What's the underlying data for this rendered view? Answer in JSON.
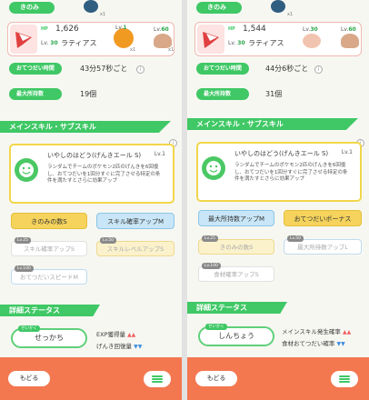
{
  "colors": {
    "green": "#3fc865",
    "orange": "#f37850",
    "yellow": "#f5d35c",
    "blue": "#c8e6f7",
    "card_pink": "#fde3e1"
  },
  "left": {
    "top_label": "きのみ",
    "fruit_count": "x1",
    "pokemon": {
      "hp_label": "HP",
      "hp_value": "1,626",
      "level_prefix": "Lv.",
      "level": "30",
      "name": "ラティアス"
    },
    "ingredients": [
      {
        "level_prefix": "Lv.",
        "level": "1",
        "count": "x1",
        "icon": "pumpkin-icon"
      },
      {
        "level_prefix": "Lv.",
        "level": "60",
        "count": "x1",
        "icon": "mushroom-icon"
      }
    ],
    "help_interval": {
      "label": "おてつだい時間",
      "value": "43分57秒ごと"
    },
    "max_inventory": {
      "label": "最大所持数",
      "value": "19個"
    },
    "section_skill": "メインスキル・サブスキル",
    "main_skill": {
      "name": "いやしのはどう(げんきエール S)",
      "level": "Lv.1",
      "description": "ランダムでチームのポケモン2匹のげんきを6回復し、おてつだいを1回分すぐに完了させる特定の条件を満たすとさらに効果アップ"
    },
    "skill_buttons": [
      {
        "label": "きのみの数S"
      },
      {
        "label": "スキル確率アップM"
      }
    ],
    "sub_skills": [
      {
        "tag": "Lv.25",
        "label": "スキル確率アップS"
      },
      {
        "tag": "Lv.50",
        "label": "スキルレベルアップS"
      },
      {
        "tag": "Lv.100",
        "label": "おてつだいスピードM"
      }
    ],
    "section_detail": "詳細ステータス",
    "nature": {
      "tag": "せいかく",
      "value": "せっかち"
    },
    "effects": [
      {
        "label": "EXP獲得量",
        "arrow": "▲▲"
      },
      {
        "label": "げんき回復量",
        "arrow": "▼▼"
      }
    ],
    "back_label": "もどる"
  },
  "right": {
    "top_label": "きのみ",
    "fruit_count": "x1",
    "pokemon": {
      "hp_label": "HP",
      "hp_value": "1,544",
      "level_prefix": "Lv.",
      "level": "30",
      "name": "ラティアス"
    },
    "ingredients": [
      {
        "level_prefix": "Lv.",
        "level": "30",
        "icon": "egg-icon"
      },
      {
        "level_prefix": "Lv.",
        "level": "60",
        "icon": "mushroom-icon"
      }
    ],
    "help_interval": {
      "label": "おてつだい時間",
      "value": "44分6秒ごと"
    },
    "max_inventory": {
      "label": "最大所持数",
      "value": "31個"
    },
    "section_skill": "メインスキル・サブスキル",
    "main_skill": {
      "name": "いやしのはどう(げんきエール S)",
      "level": "Lv.1",
      "description": "ランダムでチームのポケモン2匹のげんきを6回復し、おてつだいを1回分すぐに完了させる特定の条件を満たすとさらに効果アップ"
    },
    "skill_buttons": [
      {
        "label": "最大所持数アップM"
      },
      {
        "label": "おてつだいボーナス"
      }
    ],
    "sub_skills": [
      {
        "tag": "Lv.25",
        "label": "きのみの数S"
      },
      {
        "tag": "Lv.50",
        "label": "最大所持数アップL"
      },
      {
        "tag": "Lv.100",
        "label": "食材確率アップS"
      }
    ],
    "section_detail": "詳細ステータス",
    "nature": {
      "tag": "せいかく",
      "value": "しんちょう"
    },
    "effects": [
      {
        "label": "メインスキル発生確率",
        "arrow": "▲▲"
      },
      {
        "label": "食材おてつだい確率",
        "arrow": "▼▼"
      }
    ],
    "back_label": "もどる"
  }
}
